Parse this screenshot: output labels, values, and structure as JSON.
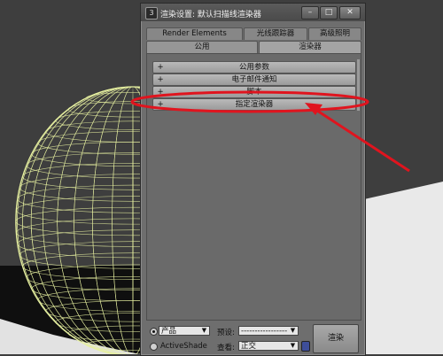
{
  "window": {
    "title": "渲染设置: 默认扫描线渲染器",
    "minimize_glyph": "–",
    "maximize_glyph": "□",
    "close_glyph": "✕"
  },
  "tabs_row1": [
    {
      "label": "Render Elements"
    },
    {
      "label": "光线跟踪器"
    },
    {
      "label": "高级照明"
    }
  ],
  "tabs_row2": [
    {
      "label": "公用"
    },
    {
      "label": "渲染器",
      "active": true
    }
  ],
  "rollouts": [
    {
      "label": "公用参数",
      "expander": "+"
    },
    {
      "label": "电子邮件通知",
      "expander": "+"
    },
    {
      "label": "脚本",
      "expander": "+"
    },
    {
      "label": "指定渲染器",
      "expander": "+",
      "highlighted": true
    }
  ],
  "bottom": {
    "mode_selected": "产品",
    "activeshade_label": "ActiveShade",
    "preset_label": "预设:",
    "preset_value": "-----------------",
    "view_label": "查看:",
    "view_value": "正交",
    "render_button": "渲染"
  },
  "colors": {
    "annotation": "#e0141e",
    "wireframe": "#e6f0a0"
  },
  "icons": {
    "app": "3ds-max-icon",
    "lock": "lock-icon"
  }
}
